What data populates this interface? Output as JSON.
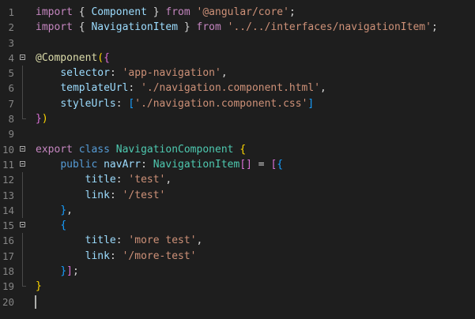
{
  "editor": {
    "language": "typescript",
    "cursor_line": 20,
    "colors": {
      "background": "#1e1e1e",
      "keyword": "#c586c0",
      "storage": "#569cd6",
      "type": "#4ec9b0",
      "variable": "#9cdcfe",
      "string": "#ce9178",
      "function": "#dcdcaa",
      "line_number": "#858585"
    },
    "lines": [
      {
        "n": "1",
        "fold": false,
        "tokens": [
          {
            "t": "import",
            "c": "kw"
          },
          {
            "t": " ",
            "c": "p"
          },
          {
            "t": "{",
            "c": "p"
          },
          {
            "t": " ",
            "c": "p"
          },
          {
            "t": "Component",
            "c": "var"
          },
          {
            "t": " } ",
            "c": "p"
          },
          {
            "t": "from",
            "c": "kw"
          },
          {
            "t": " ",
            "c": "p"
          },
          {
            "t": "'@angular/core'",
            "c": "str"
          },
          {
            "t": ";",
            "c": "p"
          }
        ]
      },
      {
        "n": "2",
        "fold": false,
        "tokens": [
          {
            "t": "import",
            "c": "kw"
          },
          {
            "t": " { ",
            "c": "p"
          },
          {
            "t": "NavigationItem",
            "c": "var"
          },
          {
            "t": " } ",
            "c": "p"
          },
          {
            "t": "from",
            "c": "kw"
          },
          {
            "t": " ",
            "c": "p"
          },
          {
            "t": "'../../interfaces/navigationItem'",
            "c": "str"
          },
          {
            "t": ";",
            "c": "p"
          }
        ]
      },
      {
        "n": "3",
        "fold": false,
        "tokens": []
      },
      {
        "n": "4",
        "fold": true,
        "tokens": [
          {
            "t": "@",
            "c": "func"
          },
          {
            "t": "Component",
            "c": "func"
          },
          {
            "t": "(",
            "c": "b1"
          },
          {
            "t": "{",
            "c": "b2"
          }
        ]
      },
      {
        "n": "5",
        "fold": false,
        "guide": true,
        "tokens": [
          {
            "t": "    ",
            "c": "p"
          },
          {
            "t": "selector",
            "c": "var"
          },
          {
            "t": ": ",
            "c": "p"
          },
          {
            "t": "'app-navigation'",
            "c": "str"
          },
          {
            "t": ",",
            "c": "p"
          }
        ]
      },
      {
        "n": "6",
        "fold": false,
        "guide": true,
        "tokens": [
          {
            "t": "    ",
            "c": "p"
          },
          {
            "t": "templateUrl",
            "c": "var"
          },
          {
            "t": ": ",
            "c": "p"
          },
          {
            "t": "'./navigation.component.html'",
            "c": "str"
          },
          {
            "t": ",",
            "c": "p"
          }
        ]
      },
      {
        "n": "7",
        "fold": false,
        "guide": true,
        "tokens": [
          {
            "t": "    ",
            "c": "p"
          },
          {
            "t": "styleUrls",
            "c": "var"
          },
          {
            "t": ": ",
            "c": "p"
          },
          {
            "t": "[",
            "c": "b3"
          },
          {
            "t": "'./navigation.component.css'",
            "c": "str"
          },
          {
            "t": "]",
            "c": "b3"
          }
        ]
      },
      {
        "n": "8",
        "fold": false,
        "guide_end": true,
        "tokens": [
          {
            "t": "}",
            "c": "b2"
          },
          {
            "t": ")",
            "c": "b1"
          }
        ]
      },
      {
        "n": "9",
        "fold": false,
        "tokens": []
      },
      {
        "n": "10",
        "fold": true,
        "tokens": [
          {
            "t": "export",
            "c": "kw"
          },
          {
            "t": " ",
            "c": "p"
          },
          {
            "t": "class",
            "c": "kw2"
          },
          {
            "t": " ",
            "c": "p"
          },
          {
            "t": "NavigationComponent",
            "c": "type"
          },
          {
            "t": " ",
            "c": "p"
          },
          {
            "t": "{",
            "c": "b1"
          }
        ]
      },
      {
        "n": "11",
        "fold": true,
        "tokens": [
          {
            "t": "    ",
            "c": "p"
          },
          {
            "t": "public",
            "c": "kw2"
          },
          {
            "t": " ",
            "c": "p"
          },
          {
            "t": "navArr",
            "c": "var"
          },
          {
            "t": ": ",
            "c": "p"
          },
          {
            "t": "NavigationItem",
            "c": "type"
          },
          {
            "t": "[]",
            "c": "b2"
          },
          {
            "t": " = ",
            "c": "p"
          },
          {
            "t": "[",
            "c": "b2"
          },
          {
            "t": "{",
            "c": "b3"
          }
        ]
      },
      {
        "n": "12",
        "fold": false,
        "guide": true,
        "tokens": [
          {
            "t": "        ",
            "c": "p"
          },
          {
            "t": "title",
            "c": "var"
          },
          {
            "t": ": ",
            "c": "p"
          },
          {
            "t": "'test'",
            "c": "str"
          },
          {
            "t": ",",
            "c": "p"
          }
        ]
      },
      {
        "n": "13",
        "fold": false,
        "guide": true,
        "tokens": [
          {
            "t": "        ",
            "c": "p"
          },
          {
            "t": "link",
            "c": "var"
          },
          {
            "t": ": ",
            "c": "p"
          },
          {
            "t": "'/test'",
            "c": "str"
          }
        ]
      },
      {
        "n": "14",
        "fold": false,
        "guide": true,
        "tokens": [
          {
            "t": "    ",
            "c": "p"
          },
          {
            "t": "}",
            "c": "b3"
          },
          {
            "t": ",",
            "c": "p"
          }
        ]
      },
      {
        "n": "15",
        "fold": true,
        "tokens": [
          {
            "t": "    ",
            "c": "p"
          },
          {
            "t": "{",
            "c": "b3"
          }
        ]
      },
      {
        "n": "16",
        "fold": false,
        "guide": true,
        "tokens": [
          {
            "t": "        ",
            "c": "p"
          },
          {
            "t": "title",
            "c": "var"
          },
          {
            "t": ": ",
            "c": "p"
          },
          {
            "t": "'more test'",
            "c": "str"
          },
          {
            "t": ",",
            "c": "p"
          }
        ]
      },
      {
        "n": "17",
        "fold": false,
        "guide": true,
        "tokens": [
          {
            "t": "        ",
            "c": "p"
          },
          {
            "t": "link",
            "c": "var"
          },
          {
            "t": ": ",
            "c": "p"
          },
          {
            "t": "'/more-test'",
            "c": "str"
          }
        ]
      },
      {
        "n": "18",
        "fold": false,
        "guide": true,
        "tokens": [
          {
            "t": "    ",
            "c": "p"
          },
          {
            "t": "}",
            "c": "b3"
          },
          {
            "t": "]",
            "c": "b2"
          },
          {
            "t": ";",
            "c": "p"
          }
        ]
      },
      {
        "n": "19",
        "fold": false,
        "guide_end": true,
        "tokens": [
          {
            "t": "}",
            "c": "b1"
          }
        ]
      },
      {
        "n": "20",
        "fold": false,
        "tokens": []
      }
    ]
  }
}
